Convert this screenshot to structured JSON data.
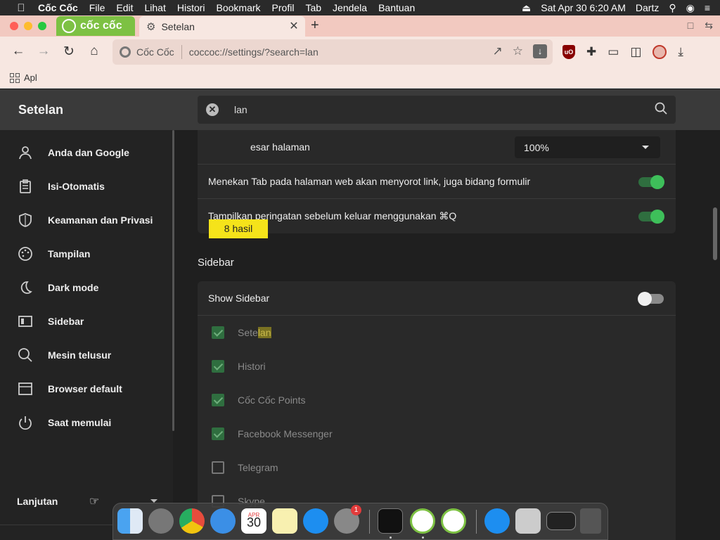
{
  "menubar": {
    "app_name": "Cốc Cốc",
    "items": [
      "File",
      "Edit",
      "Lihat",
      "Histori",
      "Bookmark",
      "Profil",
      "Tab",
      "Jendela",
      "Bantuan"
    ],
    "datetime": "Sat Apr 30  6:20 AM",
    "user": "Dartz"
  },
  "tabs": {
    "brand_label": "cốc cốc",
    "active_title": "Setelan"
  },
  "toolbar": {
    "site_label": "Cốc Cốc",
    "url": "coccoc://settings/?search=lan"
  },
  "bookmarks": {
    "apps_label": "Apl"
  },
  "settings": {
    "title": "Setelan",
    "search_value": "lan",
    "results_badge": "8 hasil",
    "nav": [
      {
        "label": "Anda dan Google",
        "icon": "person-icon"
      },
      {
        "label": "Isi-Otomatis",
        "icon": "clipboard-icon"
      },
      {
        "label": "Keamanan dan Privasi",
        "icon": "shield-icon"
      },
      {
        "label": "Tampilan",
        "icon": "palette-icon"
      },
      {
        "label": "Dark mode",
        "icon": "moon-icon"
      },
      {
        "label": "Sidebar",
        "icon": "sidebar-icon"
      },
      {
        "label": "Mesin telusur",
        "icon": "search-icon"
      },
      {
        "label": "Browser default",
        "icon": "browser-icon"
      },
      {
        "label": "Saat memulai",
        "icon": "power-icon"
      }
    ],
    "advanced_label": "Lanjutan",
    "rows": {
      "zoom_label_visible": "esar halaman",
      "zoom_value": "100%",
      "tab_highlight_label": "Menekan Tab pada halaman web akan menyorot link, juga bidang formulir",
      "tab_highlight_on": true,
      "quit_warning_label": "Tampilkan peringatan sebelum keluar menggunakan ⌘Q",
      "quit_warning_on": true
    },
    "sidebar_section": {
      "title": "Sidebar",
      "show_sidebar_label": "Show Sidebar",
      "show_sidebar_on": false,
      "items": [
        {
          "label_pre": "Sete",
          "label_hl": "lan",
          "checked": true
        },
        {
          "label_pre": "Histori",
          "label_hl": "",
          "checked": true
        },
        {
          "label_pre": "Cốc Cốc Points",
          "label_hl": "",
          "checked": true
        },
        {
          "label_pre": "Facebook Messenger",
          "label_hl": "",
          "checked": true
        },
        {
          "label_pre": "Telegram",
          "label_hl": "",
          "checked": false
        },
        {
          "label_pre": "Skype",
          "label_hl": "",
          "checked": false
        }
      ]
    }
  },
  "dock": {
    "calendar_month": "APR",
    "calendar_day": "30",
    "notification_count": "1"
  },
  "colors": {
    "accent_green": "#3ebf5a",
    "badge_yellow": "#f5e31a",
    "tab_bg": "#f2c9c0"
  }
}
